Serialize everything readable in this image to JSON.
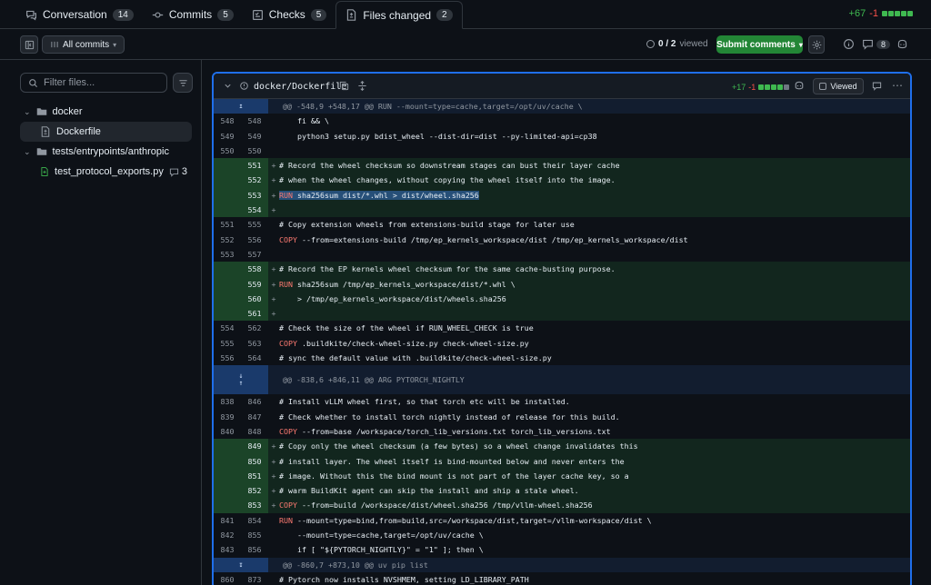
{
  "tabs": [
    {
      "label": "Conversation",
      "count": "14",
      "icon": "comment-discussion-icon"
    },
    {
      "label": "Commits",
      "count": "5",
      "icon": "commit-icon"
    },
    {
      "label": "Checks",
      "count": "5",
      "icon": "checklist-icon"
    },
    {
      "label": "Files changed",
      "count": "2",
      "icon": "file-diff-icon"
    }
  ],
  "diffstat": {
    "additions": "+67",
    "deletions": "-1",
    "blocks": [
      "g",
      "g",
      "g",
      "g",
      "g"
    ]
  },
  "toolbar": {
    "all_commits": "All commits",
    "viewed_count": "0 / 2",
    "viewed_label": "viewed",
    "submit_label": "Submit comments",
    "comment_count": "8"
  },
  "sidebar": {
    "filter_placeholder": "Filter files...",
    "tree": [
      {
        "label": "docker",
        "type": "folder"
      },
      {
        "label": "Dockerfile",
        "type": "file"
      },
      {
        "label": "tests/entrypoints/anthropic",
        "type": "folder"
      },
      {
        "label": "test_protocol_exports.py",
        "type": "file-added",
        "comments": "3"
      }
    ]
  },
  "file": {
    "name": "docker/Dockerfile",
    "additions": "+17",
    "deletions": "-1",
    "viewed_label": "Viewed"
  },
  "diff": [
    {
      "type": "hunk",
      "text": "@@ -548,9 +548,17 @@ RUN --mount=type=cache,target=/opt/uv/cache \\",
      "exp": "up"
    },
    {
      "type": "ctx",
      "old": "548",
      "new": "548",
      "code": "    fi && \\"
    },
    {
      "type": "ctx",
      "old": "549",
      "new": "549",
      "code": "    python3 setup.py bdist_wheel --dist-dir=dist --py-limited-api=cp38"
    },
    {
      "type": "ctx",
      "old": "550",
      "new": "550",
      "code": ""
    },
    {
      "type": "add",
      "old": "",
      "new": "551",
      "code": "# Record the wheel checksum so downstream stages can bust their layer cache"
    },
    {
      "type": "add",
      "old": "",
      "new": "552",
      "code": "# when the wheel changes, without copying the wheel itself into the image."
    },
    {
      "type": "add",
      "old": "",
      "new": "553",
      "code": "RUN sha256sum dist/*.whl > dist/wheel.sha256",
      "highlight": true
    },
    {
      "type": "add",
      "old": "",
      "new": "554",
      "code": ""
    },
    {
      "type": "ctx",
      "old": "551",
      "new": "555",
      "code": "# Copy extension wheels from extensions-build stage for later use"
    },
    {
      "type": "ctx",
      "old": "552",
      "new": "556",
      "code": "COPY --from=extensions-build /tmp/ep_kernels_workspace/dist /tmp/ep_kernels_workspace/dist"
    },
    {
      "type": "ctx",
      "old": "553",
      "new": "557",
      "code": ""
    },
    {
      "type": "add",
      "old": "",
      "new": "558",
      "code": "# Record the EP kernels wheel checksum for the same cache-busting purpose."
    },
    {
      "type": "add",
      "old": "",
      "new": "559",
      "code": "RUN sha256sum /tmp/ep_kernels_workspace/dist/*.whl \\"
    },
    {
      "type": "add",
      "old": "",
      "new": "560",
      "code": "    > /tmp/ep_kernels_workspace/dist/wheels.sha256"
    },
    {
      "type": "add",
      "old": "",
      "new": "561",
      "code": ""
    },
    {
      "type": "ctx",
      "old": "554",
      "new": "562",
      "code": "# Check the size of the wheel if RUN_WHEEL_CHECK is true"
    },
    {
      "type": "ctx",
      "old": "555",
      "new": "563",
      "code": "COPY .buildkite/check-wheel-size.py check-wheel-size.py"
    },
    {
      "type": "ctx",
      "old": "556",
      "new": "564",
      "code": "# sync the default value with .buildkite/check-wheel-size.py"
    },
    {
      "type": "hunk",
      "text": "@@ -838,6 +846,11 @@ ARG PYTORCH_NIGHTLY",
      "exp": "both"
    },
    {
      "type": "ctx",
      "old": "838",
      "new": "846",
      "code": "# Install vLLM wheel first, so that torch etc will be installed."
    },
    {
      "type": "ctx",
      "old": "839",
      "new": "847",
      "code": "# Check whether to install torch nightly instead of release for this build."
    },
    {
      "type": "ctx",
      "old": "840",
      "new": "848",
      "code": "COPY --from=base /workspace/torch_lib_versions.txt torch_lib_versions.txt"
    },
    {
      "type": "add",
      "old": "",
      "new": "849",
      "code": "# Copy only the wheel checksum (a few bytes) so a wheel change invalidates this"
    },
    {
      "type": "add",
      "old": "",
      "new": "850",
      "code": "# install layer. The wheel itself is bind-mounted below and never enters the"
    },
    {
      "type": "add",
      "old": "",
      "new": "851",
      "code": "# image. Without this the bind mount is not part of the layer cache key, so a"
    },
    {
      "type": "add",
      "old": "",
      "new": "852",
      "code": "# warm BuildKit agent can skip the install and ship a stale wheel."
    },
    {
      "type": "add",
      "old": "",
      "new": "853",
      "code": "COPY --from=build /workspace/dist/wheel.sha256 /tmp/vllm-wheel.sha256"
    },
    {
      "type": "ctx",
      "old": "841",
      "new": "854",
      "code": "RUN --mount=type=bind,from=build,src=/workspace/dist,target=/vllm-workspace/dist \\"
    },
    {
      "type": "ctx",
      "old": "842",
      "new": "855",
      "code": "    --mount=type=cache,target=/opt/uv/cache \\"
    },
    {
      "type": "ctx",
      "old": "843",
      "new": "856",
      "code": "    if [ \"${PYTORCH_NIGHTLY}\" = \"1\" ]; then \\"
    },
    {
      "type": "hunk",
      "text": "@@ -860,7 +873,10 @@ uv pip list",
      "exp": "down"
    },
    {
      "type": "ctx",
      "old": "860",
      "new": "873",
      "code": "# Pytorch now installs NVSHMEM, setting LD_LIBRARY_PATH"
    }
  ]
}
